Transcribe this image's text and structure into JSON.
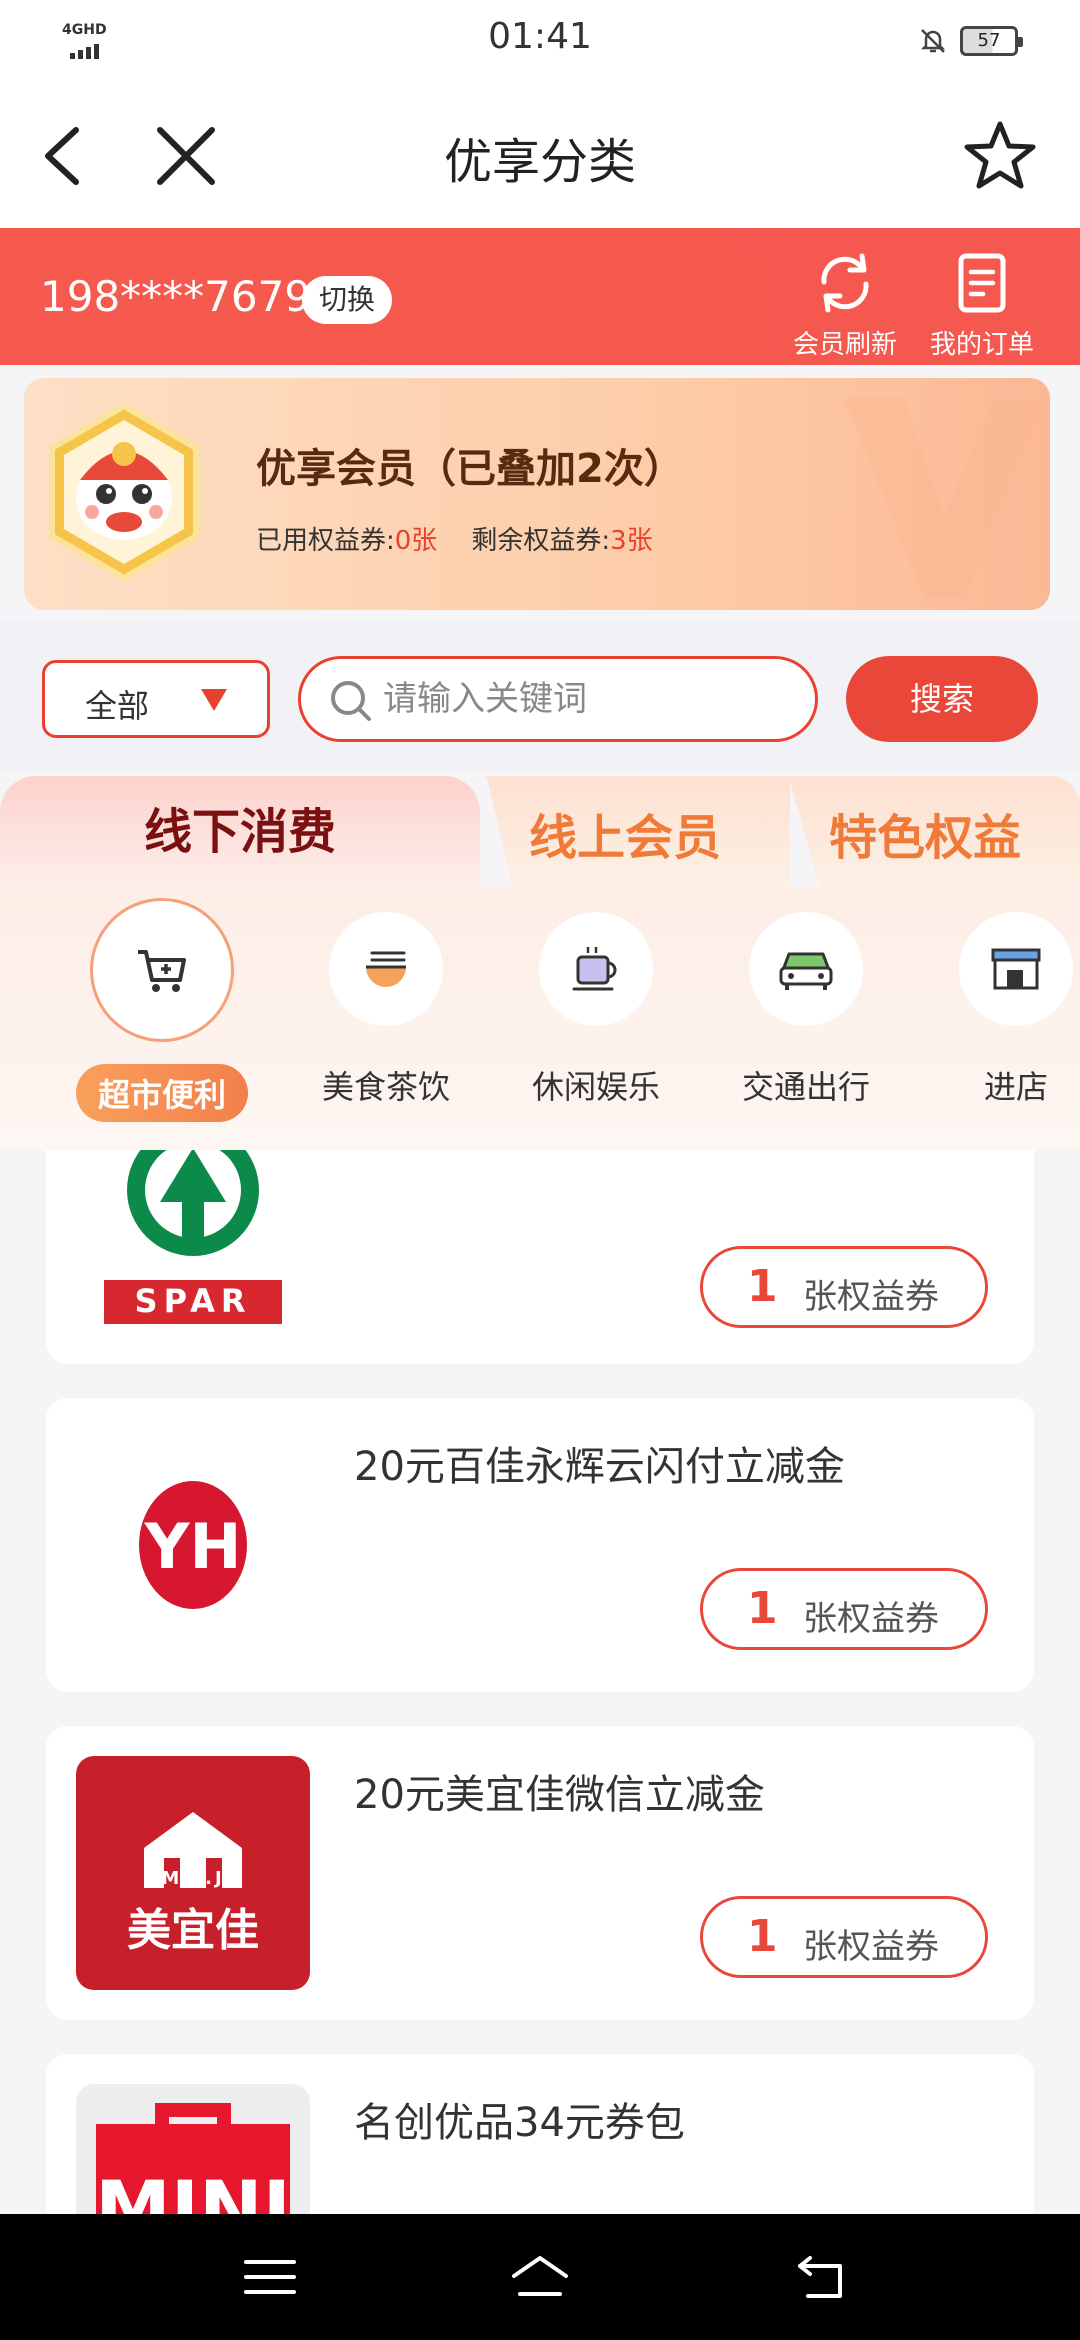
{
  "status": {
    "network": "4GHD",
    "time": "01:41",
    "battery": "57"
  },
  "nav": {
    "title": "优享分类"
  },
  "account": {
    "phone": "198****7679",
    "switch_label": "切换",
    "refresh_label": "会员刷新",
    "orders_label": "我的订单"
  },
  "member": {
    "title": "优享会员（已叠加2次）",
    "used_label": "已用权益券:",
    "used_value": "0张",
    "remaining_label": "剩余权益券:",
    "remaining_value": "3张"
  },
  "search": {
    "filter_label": "全部",
    "placeholder": "请输入关键词",
    "button_label": "搜索"
  },
  "tabs": [
    {
      "label": "线下消费",
      "active": true
    },
    {
      "label": "线上会员",
      "active": false
    },
    {
      "label": "特色权益",
      "active": false
    }
  ],
  "categories": [
    {
      "label": "超市便利",
      "icon": "cart-icon",
      "active": true
    },
    {
      "label": "美食茶饮",
      "icon": "bowl-icon",
      "active": false
    },
    {
      "label": "休闲娱乐",
      "icon": "coffee-cup-icon",
      "active": false
    },
    {
      "label": "交通出行",
      "icon": "car-icon",
      "active": false
    },
    {
      "label": "进店",
      "icon": "store-icon",
      "active": false
    }
  ],
  "products": [
    {
      "title": "",
      "logo": "spar-logo",
      "count": "1",
      "unit": "张权益券"
    },
    {
      "title": "20元百佳永辉云闪付立减金",
      "logo": "yh-logo",
      "count": "1",
      "unit": "张权益券"
    },
    {
      "title": "20元美宜佳微信立减金",
      "logo": "myj-logo",
      "logo_text": "美宜佳",
      "logo_sub": "M.Y.J",
      "count": "1",
      "unit": "张权益券"
    },
    {
      "title": "名创优品34元券包",
      "logo": "miniso-logo",
      "logo_text": "MINI",
      "count": "",
      "unit": ""
    }
  ],
  "colors": {
    "accent": "#e8473a",
    "header_bg": "#f65a4e",
    "tab_active_text": "#7a1010",
    "tab_inactive_text": "#f07a38"
  }
}
